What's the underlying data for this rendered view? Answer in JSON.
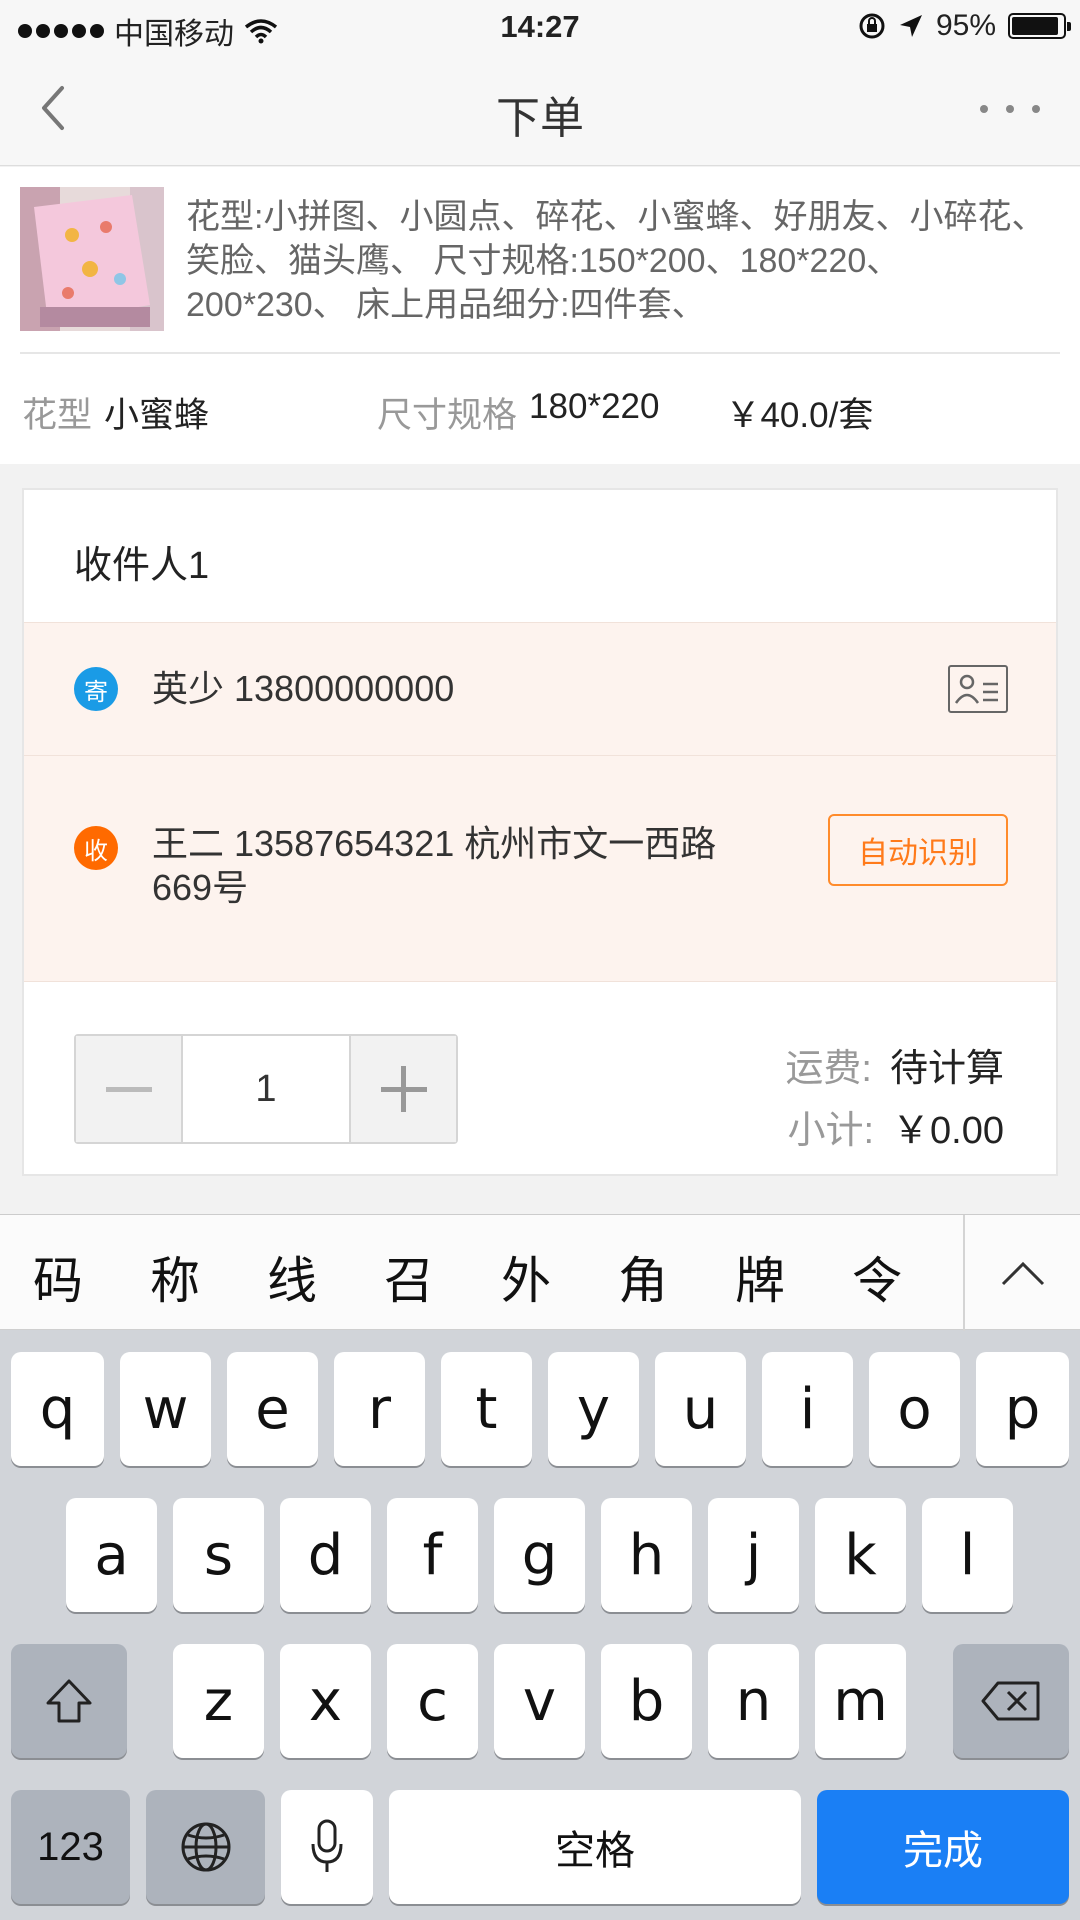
{
  "status": {
    "carrier": "中国移动",
    "time": "14:27",
    "battery": "95%"
  },
  "nav": {
    "title": "下单",
    "back_icon": "chevron-left-icon",
    "more_icon": "more-dots-icon"
  },
  "product": {
    "description": "花型:小拼图、小圆点、碎花、小蜜蜂、好朋友、小碎花、笑脸、猫头鹰、 尺寸规格:150*200、180*220、200*230、 床上用品细分:四件套、",
    "pattern_label": "花型",
    "pattern_value": "小蜜蜂",
    "size_label": "尺寸规格",
    "size_value": "180*220",
    "price": "￥40.0/套"
  },
  "recipient": {
    "heading": "收件人1",
    "sender_badge": "寄",
    "sender_text": "英少 13800000000",
    "receiver_badge": "收",
    "receiver_text": "王二 13587654321 杭州市文一西路669号",
    "auto_button": "自动识别"
  },
  "quantity": {
    "value": "1"
  },
  "summary": {
    "shipping_label": "运费:",
    "shipping_value": "待计算",
    "subtotal_label": "小计:",
    "subtotal_value": "￥0.00"
  },
  "keyboard": {
    "candidates": [
      "码",
      "称",
      "线",
      "召",
      "外",
      "角",
      "牌",
      "令"
    ],
    "row1": [
      "q",
      "w",
      "e",
      "r",
      "t",
      "y",
      "u",
      "i",
      "o",
      "p"
    ],
    "row2": [
      "a",
      "s",
      "d",
      "f",
      "g",
      "h",
      "j",
      "k",
      "l"
    ],
    "row3": [
      "z",
      "x",
      "c",
      "v",
      "b",
      "n",
      "m"
    ],
    "num_key": "123",
    "space_key": "空格",
    "done_key": "完成"
  },
  "colors": {
    "accent_orange": "#ff7a1a",
    "sender_blue": "#1a9be6",
    "done_blue": "#1a7ff5",
    "row_bg": "#fdf3ee"
  }
}
